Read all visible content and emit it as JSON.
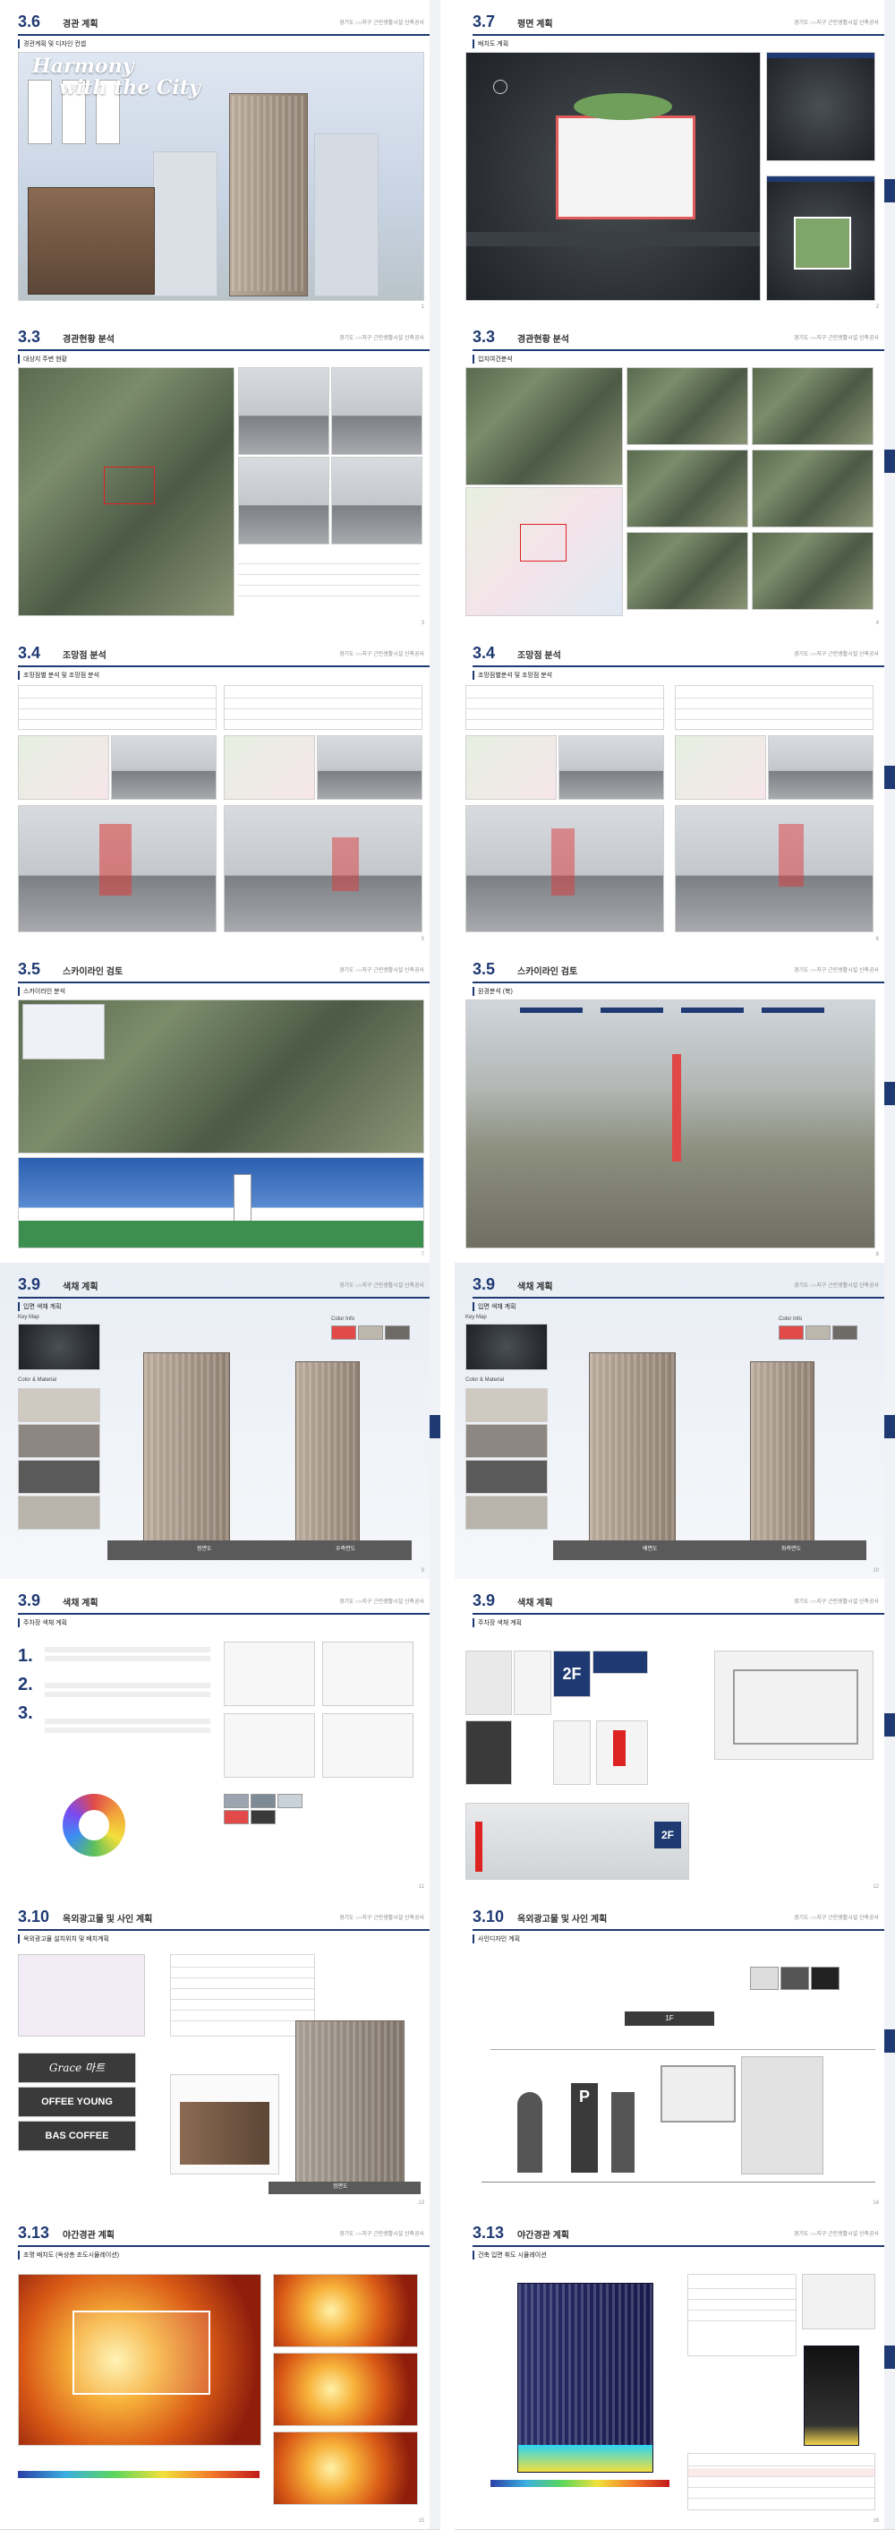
{
  "pages": [
    {
      "num": "3.6",
      "title": "경관 계획",
      "sub": "경관계획 및 디자인 컨셉",
      "headline_1": "Harmony",
      "headline_2": "with the City",
      "pg": "1"
    },
    {
      "num": "3.7",
      "title": "평면 계획",
      "sub": "배치도 계획",
      "pg": "2"
    },
    {
      "num": "3.3",
      "title": "경관현황 분석",
      "sub": "대상지 주변 현황",
      "pg": "3"
    },
    {
      "num": "3.3",
      "title": "경관현황 분석",
      "sub": "입지여건분석",
      "pg": "4"
    },
    {
      "num": "3.4",
      "title": "조망점 분석",
      "sub": "조망점별 분석 및 조망점 분석",
      "pg": "5"
    },
    {
      "num": "3.4",
      "title": "조망점 분석",
      "sub": "조망점별분석 및 조망점 분석",
      "pg": "6"
    },
    {
      "num": "3.5",
      "title": "스카이라인 검토",
      "sub": "스카이라인 분석",
      "pg": "7"
    },
    {
      "num": "3.5",
      "title": "스카이라인 검토",
      "sub": "원경분석 (북)",
      "pg": "8"
    },
    {
      "num": "3.9",
      "title": "색채 계획",
      "sub": "입면 색채 계획",
      "pg": "9"
    },
    {
      "num": "3.9",
      "title": "색채 계획",
      "sub": "입면 색채 계획",
      "pg": "10"
    },
    {
      "num": "3.9",
      "title": "색채 계획",
      "sub": "주차장 색채 계획",
      "pg": "11"
    },
    {
      "num": "3.9",
      "title": "색채 계획",
      "sub": "주차장 색채 계획",
      "pg": "12"
    },
    {
      "num": "3.10",
      "title": "옥외광고물 및 사인 계획",
      "sub": "옥외광고물 설치위치 및 배치계획",
      "pg": "13"
    },
    {
      "num": "3.10",
      "title": "옥외광고물 및 사인 계획",
      "sub": "사인디자인 계획",
      "pg": "14"
    },
    {
      "num": "3.13",
      "title": "야간경관 계획",
      "sub": "조명 배치도 (옥상층 조도시뮬레이션)",
      "pg": "15"
    },
    {
      "num": "3.13",
      "title": "야간경관 계획",
      "sub": "건축 입면 휘도 시뮬레이션",
      "pg": "16"
    }
  ],
  "project_name": "경기도 ○○지구 근린생활시설 신축공사",
  "brands": [
    "Grace 마트",
    "OFFEE YOUNG",
    "BAS COFFEE"
  ],
  "parking_label": "P",
  "floor_label": "2F",
  "floor_label_1f": "1F",
  "labels": {
    "key_map": "Key Map",
    "color_info": "Color Info",
    "color_material": "Color & Material",
    "elev_front": "정면도",
    "elev_right": "우측면도",
    "elev_back": "배면도",
    "elev_left": "좌측면도"
  },
  "colors": {
    "brand_blue": "#1f3a73",
    "accent_red": "#d22222"
  }
}
